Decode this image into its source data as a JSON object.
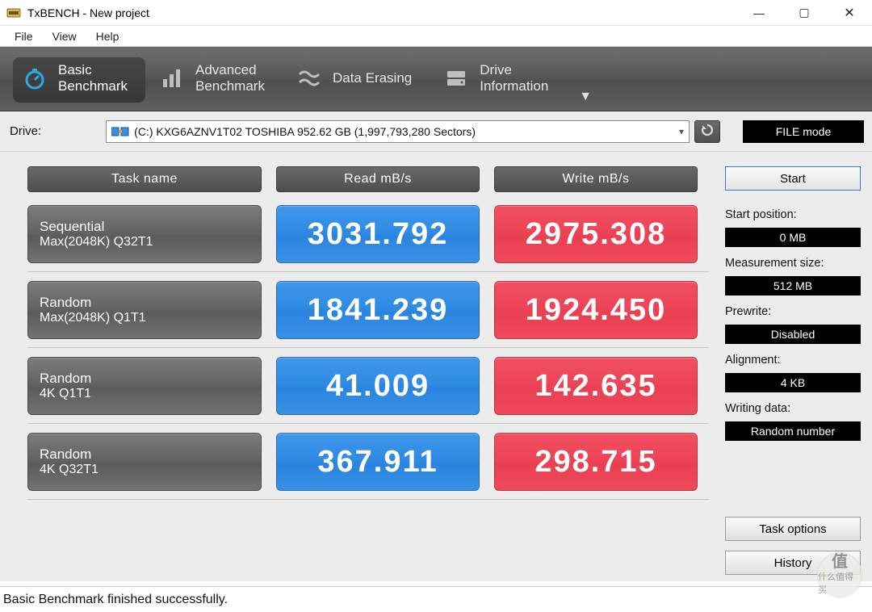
{
  "window": {
    "title": "TxBENCH - New project"
  },
  "menu": {
    "file": "File",
    "view": "View",
    "help": "Help"
  },
  "tabs": {
    "basic_l1": "Basic",
    "basic_l2": "Benchmark",
    "adv_l1": "Advanced",
    "adv_l2": "Benchmark",
    "erase": "Data Erasing",
    "drive_l1": "Drive",
    "drive_l2": "Information"
  },
  "drivebar": {
    "label": "Drive:",
    "selected": "(C:) KXG6AZNV1T02 TOSHIBA  952.62 GB (1,997,793,280 Sectors)",
    "file_mode": "FILE mode"
  },
  "headers": {
    "task": "Task name",
    "read": "Read mB/s",
    "write": "Write mB/s"
  },
  "rows": [
    {
      "name1": "Sequential",
      "name2": "Max(2048K) Q32T1",
      "read": "3031.792",
      "write": "2975.308"
    },
    {
      "name1": "Random",
      "name2": "Max(2048K) Q1T1",
      "read": "1841.239",
      "write": "1924.450"
    },
    {
      "name1": "Random",
      "name2": "4K Q1T1",
      "read": "41.009",
      "write": "142.635"
    },
    {
      "name1": "Random",
      "name2": "4K Q32T1",
      "read": "367.911",
      "write": "298.715"
    }
  ],
  "side": {
    "start": "Start",
    "start_pos_lbl": "Start position:",
    "start_pos_val": "0 MB",
    "meas_lbl": "Measurement size:",
    "meas_val": "512 MB",
    "prewrite_lbl": "Prewrite:",
    "prewrite_val": "Disabled",
    "align_lbl": "Alignment:",
    "align_val": "4 KB",
    "wdata_lbl": "Writing data:",
    "wdata_val": "Random number",
    "task_opts": "Task options",
    "history": "History"
  },
  "status": "Basic Benchmark finished successfully.",
  "watermark": {
    "char": "值",
    "sub": "什么值得买"
  }
}
